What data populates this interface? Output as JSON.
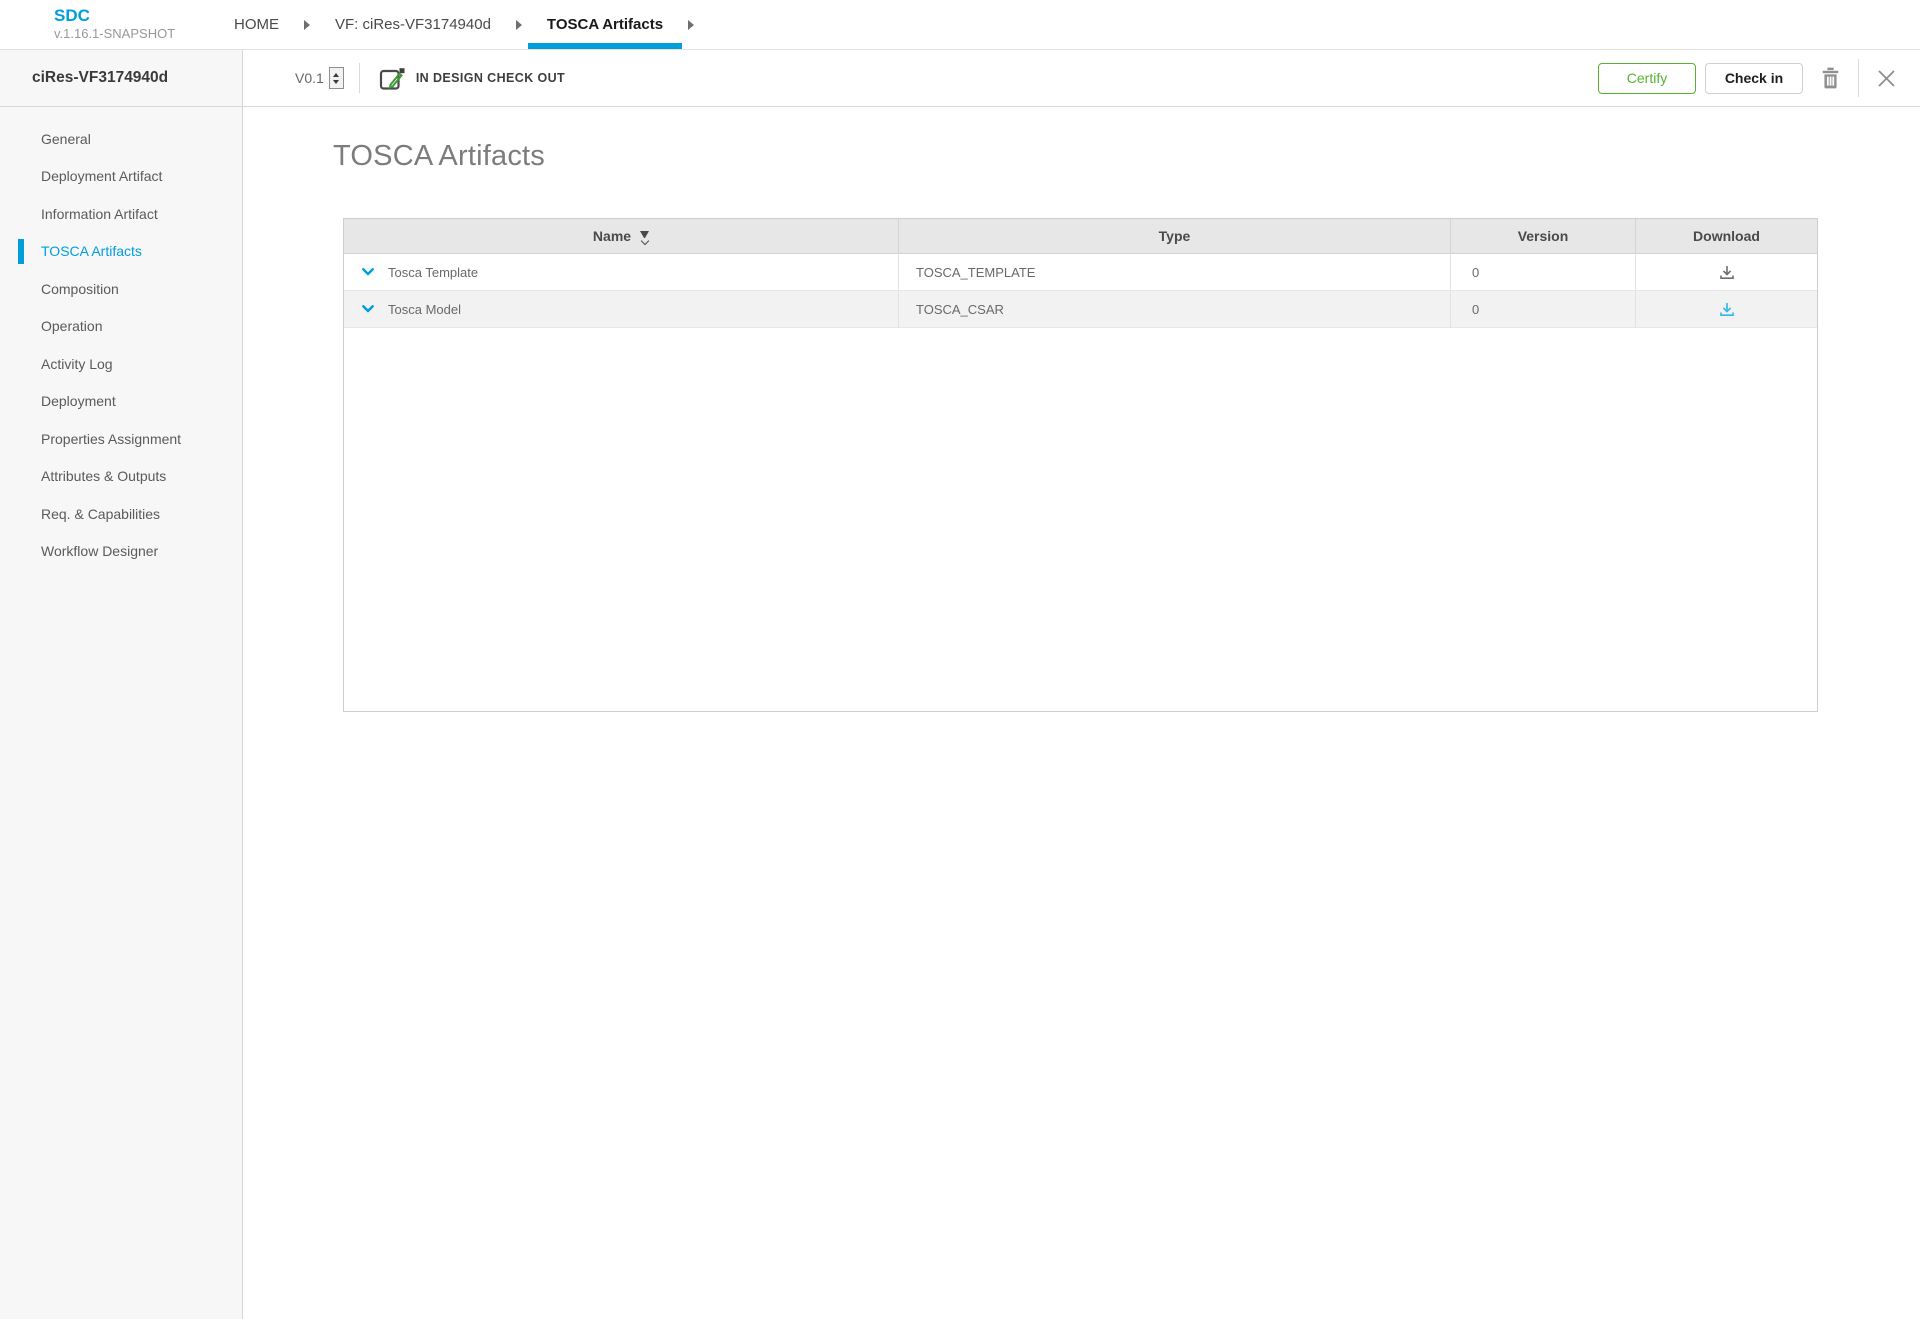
{
  "app": {
    "name": "SDC",
    "version": "v.1.16.1-SNAPSHOT"
  },
  "breadcrumbs": [
    "HOME",
    "VF: ciRes-VF3174940d",
    "TOSCA Artifacts"
  ],
  "nav": {
    "active_tab": "TOSCA Artifacts"
  },
  "sidebar": {
    "title": "ciRes-VF3174940d",
    "active_item": "TOSCA Artifacts",
    "items": [
      "General",
      "Deployment Artifact",
      "Information Artifact",
      "TOSCA Artifacts",
      "Composition",
      "Operation",
      "Activity Log",
      "Deployment",
      "Properties Assignment",
      "Attributes & Outputs",
      "Req. & Capabilities",
      "Workflow Designer"
    ]
  },
  "toolbar": {
    "version": "V0.1",
    "state": "IN DESIGN CHECK OUT",
    "certify": "Certify",
    "checkin": "Check in",
    "icons": {
      "state": "edit-pencil-icon",
      "delete": "trash-icon",
      "close": "close-icon",
      "version_stepper": "stepper-arrows-icon"
    }
  },
  "main": {
    "title": "TOSCA Artifacts",
    "table": {
      "columns": [
        "Name",
        "Type",
        "Version",
        "Download"
      ],
      "sorted_column": "Name",
      "rows": [
        {
          "name": "Tosca Template",
          "type": "TOSCA_TEMPLATE",
          "version": "0",
          "expand_icon": "chevron-down-icon",
          "download_icon": "download-icon",
          "download_color": "#6e6e6e"
        },
        {
          "name": "Tosca Model",
          "type": "TOSCA_CSAR",
          "version": "0",
          "expand_icon": "chevron-down-icon",
          "download_icon": "download-icon",
          "download_color": "#30b6ea"
        }
      ]
    }
  },
  "colors": {
    "accent_blue": "#009fdb",
    "certify_green": "#57b32f",
    "header_bg": "#e7e7e7",
    "row_alt_bg": "#f2f2f2",
    "sidebar_bg": "#f7f7f7"
  }
}
